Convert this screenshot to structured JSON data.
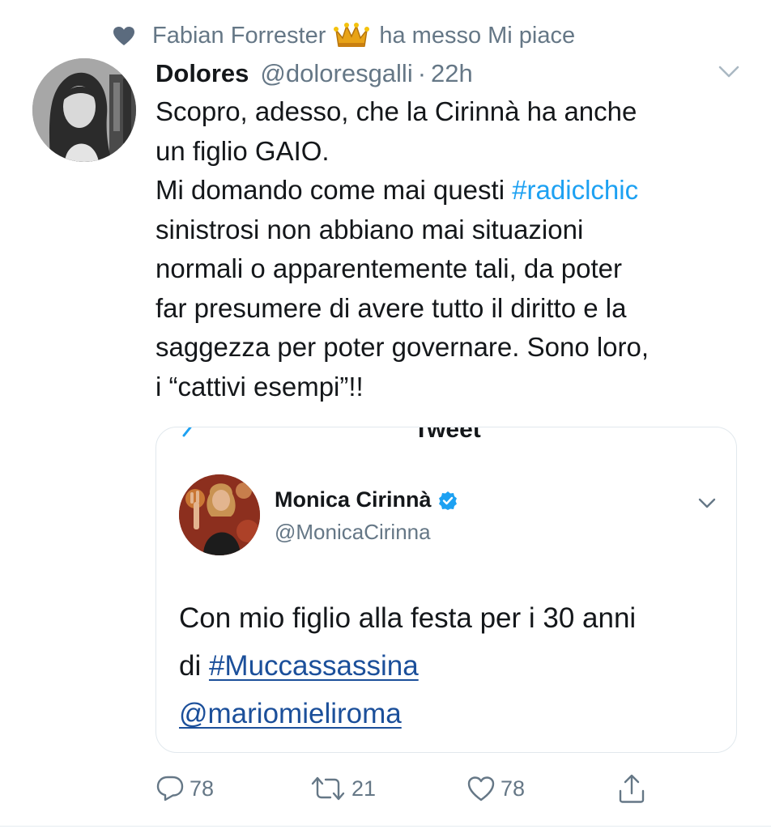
{
  "social_context": {
    "user": "Fabian Forrester",
    "action": "ha messo Mi piace",
    "icon": "heart-icon",
    "badge_icon": "crown-icon"
  },
  "tweet": {
    "display_name": "Dolores",
    "handle": "@doloresgalli",
    "separator": "·",
    "timestamp": "22h",
    "text_lines": {
      "l1": "Scopro, adesso, che la Cirinnà ha anche",
      "l2": "un figlio GAIO.",
      "l3_pre": "Mi domando come mai questi ",
      "l3_hashtag": "#radiclchic",
      "l4": "sinistrosi non abbiano mai situazioni",
      "l5": "normali o apparentemente tali, da poter",
      "l6": "far presumere di avere tutto il diritto e la",
      "l7": "saggezza per poter governare. Sono loro,",
      "l8": "i “cattivi esempi”!!"
    }
  },
  "quoted_tweet": {
    "header_cut": "Tweet",
    "display_name": "Monica Cirinnà",
    "verified": true,
    "handle": "@MonicaCirinna",
    "line1": "Con mio figlio alla festa per i 30 anni",
    "line2_pre": "di ",
    "line2_hashtag": "#Muccassassina",
    "line3_mention": "@mariomieliroma"
  },
  "actions": {
    "reply_count": "78",
    "retweet_count": "21",
    "like_count": "78"
  },
  "colors": {
    "link": "#1da1f2",
    "quote_link": "#1b4f9a",
    "secondary": "#657786",
    "verified": "#1da1f2"
  }
}
